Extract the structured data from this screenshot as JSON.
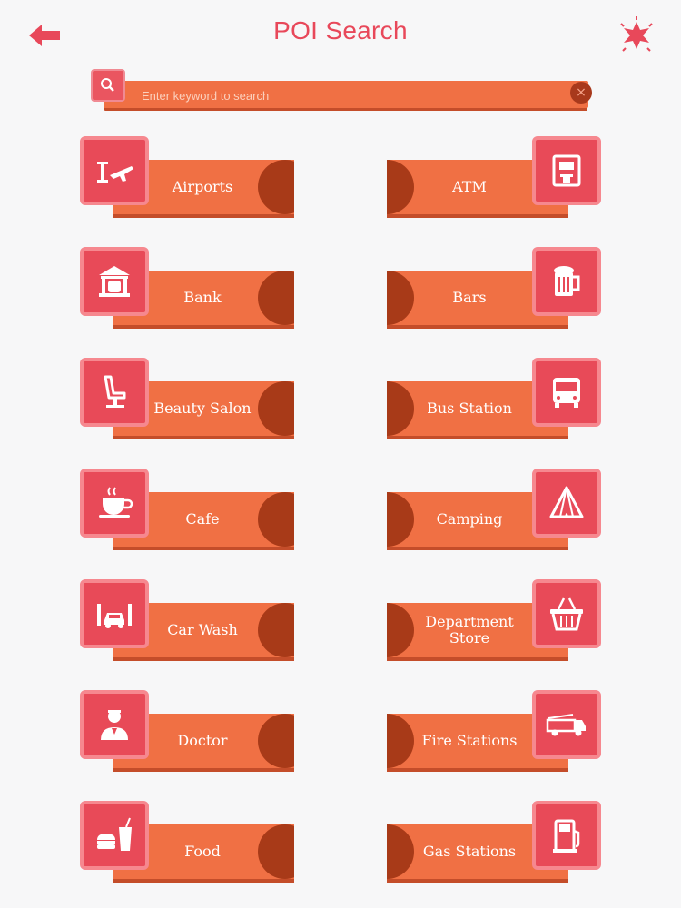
{
  "header": {
    "title": "POI Search"
  },
  "search": {
    "placeholder": "Enter keyword to search",
    "clear_label": "×"
  },
  "categories": {
    "airports": "Airports",
    "atm": "ATM",
    "bank": "Bank",
    "bars": "Bars",
    "beauty_salon": "Beauty Salon",
    "bus_station": "Bus Station",
    "cafe": "Cafe",
    "camping": "Camping",
    "car_wash": "Car Wash",
    "department_store": "Department Store",
    "doctor": "Doctor",
    "fire_stations": "Fire Stations",
    "food": "Food",
    "gas_stations": "Gas Stations"
  },
  "colors": {
    "accent": "#e8485a",
    "band": "#f07044",
    "band_dark": "#a83a18",
    "icon_tile": "#e84a58"
  },
  "icons": {
    "back": "back-arrow-icon",
    "favorite": "star-burst-icon",
    "search": "search-icon",
    "clear": "close-icon"
  }
}
